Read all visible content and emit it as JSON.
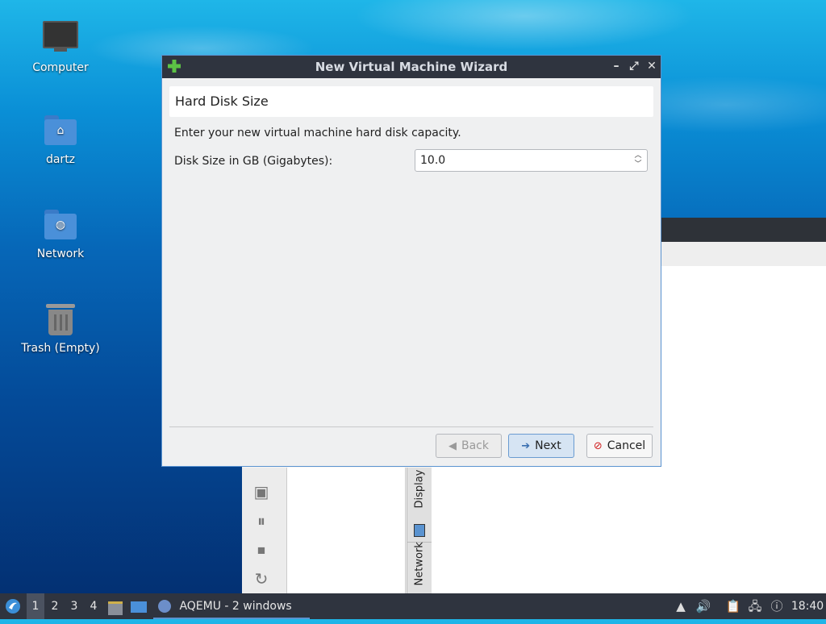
{
  "desktop": {
    "icons": [
      {
        "label": "Computer"
      },
      {
        "label": "dartz"
      },
      {
        "label": "Network"
      },
      {
        "label": "Trash (Empty)"
      }
    ]
  },
  "background_app": {
    "tabs": [
      {
        "label": "Display"
      },
      {
        "label": "Network"
      }
    ]
  },
  "dialog": {
    "title": "New Virtual Machine Wizard",
    "page_header": "Hard Disk Size",
    "description": "Enter your new virtual machine hard disk capacity.",
    "disk_size_label": "Disk Size in GB (Gigabytes):",
    "disk_size_value": "10.0",
    "buttons": {
      "back": "Back",
      "next": "Next",
      "cancel": "Cancel"
    }
  },
  "taskbar": {
    "workspaces": [
      "1",
      "2",
      "3",
      "4"
    ],
    "active_workspace": "1",
    "task_label": "AQEMU - 2 windows",
    "clock": "18:40"
  },
  "colors": {
    "titlebar": "#2f343f",
    "accent": "#5a93d0",
    "taskbar": "#2f343f"
  }
}
